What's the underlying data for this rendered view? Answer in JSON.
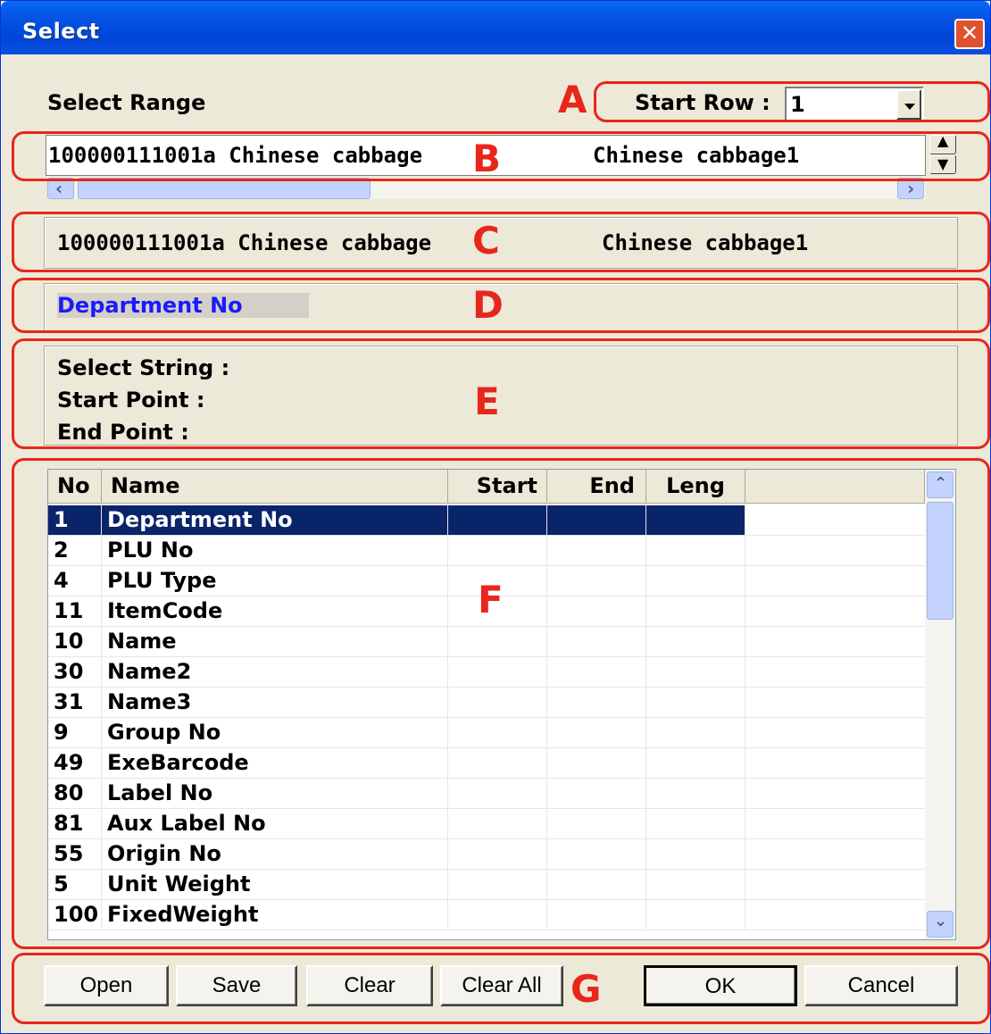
{
  "window": {
    "title": "Select",
    "close_glyph": "✕"
  },
  "range": {
    "label": "Select Range",
    "start_row_label": "Start Row :",
    "start_row_value": "1"
  },
  "preview": {
    "line_code": "100000111001a Chinese cabbage",
    "line_name": "Chinese cabbage1"
  },
  "selected_line": {
    "code": "100000111001a Chinese cabbage",
    "name": "Chinese cabbage1"
  },
  "field": {
    "current": "Department No"
  },
  "info": {
    "select_string": "Select String :",
    "start_point": "Start Point :",
    "end_point": "End Point  :"
  },
  "table": {
    "headers": [
      "No",
      "Name",
      "Start",
      "End",
      "Leng"
    ],
    "rows": [
      {
        "no": "1",
        "name": "Department No"
      },
      {
        "no": "2",
        "name": "PLU No"
      },
      {
        "no": "4",
        "name": "PLU Type"
      },
      {
        "no": "11",
        "name": "ItemCode"
      },
      {
        "no": "10",
        "name": "Name"
      },
      {
        "no": "30",
        "name": "Name2"
      },
      {
        "no": "31",
        "name": "Name3"
      },
      {
        "no": "9",
        "name": "Group No"
      },
      {
        "no": "49",
        "name": "ExeBarcode"
      },
      {
        "no": "80",
        "name": "Label No"
      },
      {
        "no": "81",
        "name": "Aux Label No"
      },
      {
        "no": "55",
        "name": "Origin No"
      },
      {
        "no": "5",
        "name": "Unit Weight"
      },
      {
        "no": "100",
        "name": "FixedWeight"
      }
    ]
  },
  "buttons": {
    "open": "Open",
    "save": "Save",
    "clear": "Clear",
    "clear_all": "Clear All",
    "ok": "OK",
    "cancel": "Cancel"
  },
  "annotations": {
    "a": "A",
    "b": "B",
    "c": "C",
    "d": "D",
    "e": "E",
    "f": "F",
    "g": "G"
  },
  "colors": {
    "annotation": "#e8261b",
    "title_bar": "#0554e3",
    "selection": "#0a246a",
    "field_text": "#1a1aff"
  }
}
